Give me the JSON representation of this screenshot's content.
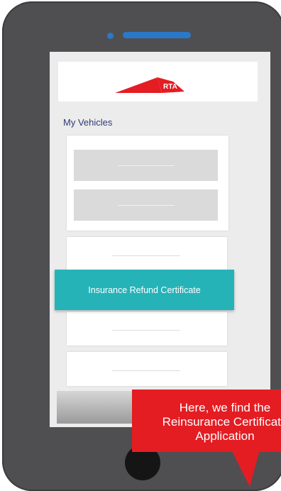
{
  "header": {
    "logo_text": "RTA"
  },
  "main": {
    "section_title": "My Vehicles",
    "highlight_label": "Insurance Refund Certificate"
  },
  "callout": {
    "lines": [
      "Here, we find the",
      "Reinsurance Certificate",
      "Application"
    ]
  },
  "colors": {
    "brand_red": "#e41d23",
    "highlight_teal": "#26b3b8",
    "phone_body": "#4f4f52",
    "speaker_blue": "#2a79c8",
    "title_navy": "#2e3a78"
  },
  "icons": [
    "rta-logo-icon",
    "home-button-icon"
  ]
}
